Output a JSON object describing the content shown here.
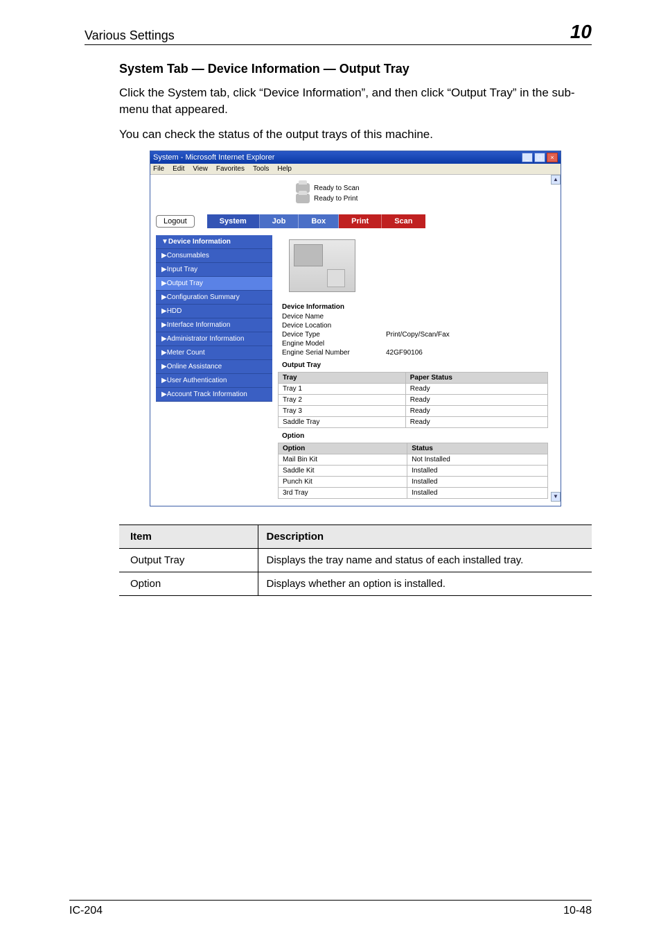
{
  "header": {
    "section": "Various Settings",
    "chapter": "10"
  },
  "body": {
    "heading": "System Tab — Device Information — Output Tray",
    "p1": "Click the System tab, click “Device Information”, and then click “Output Tray” in the sub-menu that appeared.",
    "p2": "You can check the status of the output trays of this machine."
  },
  "ie": {
    "title": "System - Microsoft Internet Explorer",
    "menu": {
      "file": "File",
      "edit": "Edit",
      "view": "View",
      "fav": "Favorites",
      "tools": "Tools",
      "help": "Help"
    },
    "banner": {
      "scan": "Ready to Scan",
      "print": "Ready to Print"
    },
    "logout": "Logout",
    "tabs": {
      "system": "System",
      "job": "Job",
      "box": "Box",
      "print": "Print",
      "scan": "Scan"
    },
    "side": {
      "hdr": "▼Device Information",
      "items": [
        "▶Consumables",
        "▶Input Tray",
        "▶Output Tray",
        "▶Configuration Summary",
        "▶HDD",
        "▶Interface Information",
        "▶Administrator Information",
        "▶Meter Count",
        "▶Online Assistance",
        "▶User Authentication",
        "▶Account Track Information"
      ]
    },
    "panel": {
      "devinfo_title": "Device Information",
      "kv": [
        {
          "k": "Device Name",
          "v": ""
        },
        {
          "k": "Device Location",
          "v": ""
        },
        {
          "k": "Device Type",
          "v": "Print/Copy/Scan/Fax"
        },
        {
          "k": "Engine Model",
          "v": ""
        },
        {
          "k": "Engine Serial Number",
          "v": "42GF90106"
        }
      ],
      "out_title": "Output Tray",
      "out_head": {
        "c1": "Tray",
        "c2": "Paper Status"
      },
      "out_rows": [
        {
          "c1": "Tray 1",
          "c2": "Ready"
        },
        {
          "c1": "Tray 2",
          "c2": "Ready"
        },
        {
          "c1": "Tray 3",
          "c2": "Ready"
        },
        {
          "c1": "Saddle Tray",
          "c2": "Ready"
        }
      ],
      "opt_title": "Option",
      "opt_head": {
        "c1": "Option",
        "c2": "Status"
      },
      "opt_rows": [
        {
          "c1": "Mail Bin Kit",
          "c2": "Not Installed"
        },
        {
          "c1": "Saddle Kit",
          "c2": "Installed"
        },
        {
          "c1": "Punch Kit",
          "c2": "Installed"
        },
        {
          "c1": "3rd Tray",
          "c2": "Installed"
        }
      ]
    }
  },
  "desc": {
    "head": {
      "c1": "Item",
      "c2": "Description"
    },
    "rows": [
      {
        "c1": "Output Tray",
        "c2": "Displays the tray name and status of each installed tray."
      },
      {
        "c1": "Option",
        "c2": "Displays whether an option is installed."
      }
    ]
  },
  "footer": {
    "left": "IC-204",
    "right": "10-48"
  }
}
